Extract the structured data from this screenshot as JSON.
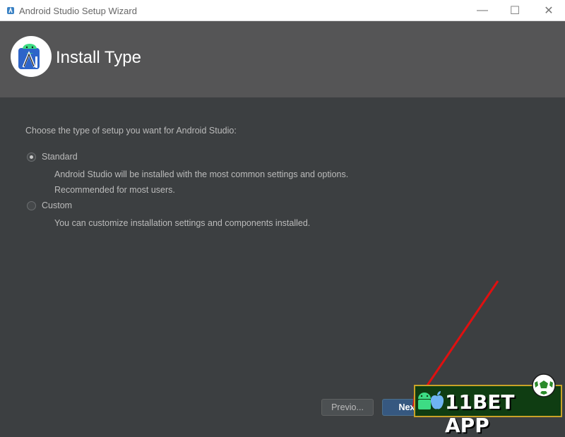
{
  "window": {
    "title": "Android Studio Setup Wizard",
    "minimize_glyph": "—",
    "maximize_glyph": "☐",
    "close_glyph": "✕"
  },
  "header": {
    "title": "Install Type",
    "logo_icon": "android-studio-icon"
  },
  "main": {
    "prompt": "Choose the type of setup you want for Android Studio:",
    "options": [
      {
        "label": "Standard",
        "selected": true,
        "description": [
          "Android Studio will be installed with the most common settings and options.",
          "Recommended for most users."
        ]
      },
      {
        "label": "Custom",
        "selected": false,
        "description": [
          "You can customize installation settings and components installed."
        ]
      }
    ]
  },
  "footer": {
    "previous_label": "Previo...",
    "next_label": "Next"
  },
  "overlay": {
    "banner_text": "11BET APP"
  },
  "colors": {
    "header_bg": "#555556",
    "content_bg": "#3c3f41",
    "text": "#bbbbbb",
    "next_button": "#365880",
    "arrow": "#e01010"
  }
}
